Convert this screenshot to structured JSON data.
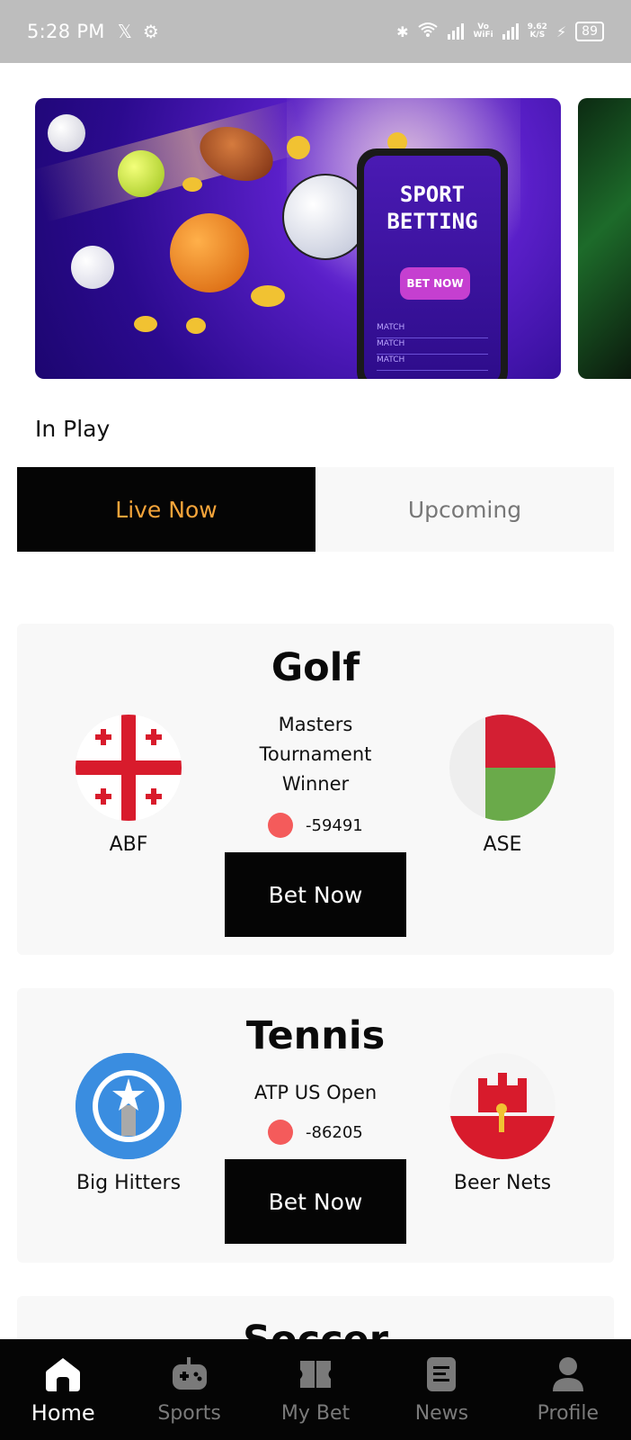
{
  "status_bar": {
    "time": "5:28 PM",
    "left_icons": [
      "x-icon",
      "settings-icon"
    ],
    "right_icons": [
      "bluetooth-icon",
      "wifi-icon",
      "signal-icon",
      "vowifi-icon",
      "signal-icon",
      "charging-icon"
    ],
    "vo_wifi_top": "Vo",
    "vo_wifi_bottom": "WiFi",
    "speed_value": "9.62",
    "speed_unit": "K/S",
    "battery": "89"
  },
  "banner": {
    "phone_title_line1": "SPORT",
    "phone_title_line2": "BETTING",
    "phone_button": "BET NOW",
    "phone_rows": [
      "MATCH",
      "MATCH",
      "MATCH"
    ]
  },
  "in_play": {
    "title": "In Play",
    "tabs": [
      {
        "label": "Live Now",
        "active": true
      },
      {
        "label": "Upcoming",
        "active": false
      }
    ]
  },
  "matches": [
    {
      "sport": "Golf",
      "team_left": "ABF",
      "team_right": "ASE",
      "event": "Masters Tournament Winner",
      "odds": "-59491",
      "bet_label": "Bet Now"
    },
    {
      "sport": "Tennis",
      "team_left": "Big Hitters",
      "team_right": "Beer Nets",
      "event": "ATP US Open",
      "odds": "-86205",
      "bet_label": "Bet Now"
    },
    {
      "sport": "Soccer"
    }
  ],
  "bottom_nav": [
    {
      "label": "Home",
      "icon": "home-icon",
      "active": true
    },
    {
      "label": "Sports",
      "icon": "gamepad-icon",
      "active": false
    },
    {
      "label": "My Bet",
      "icon": "ticket-icon",
      "active": false
    },
    {
      "label": "News",
      "icon": "news-icon",
      "active": false
    },
    {
      "label": "Profile",
      "icon": "profile-icon",
      "active": false
    }
  ],
  "colors": {
    "accent": "#f5a43a",
    "dark": "#050505",
    "card_bg": "#f8f8f8",
    "odds_dot": "#f45b5b"
  }
}
